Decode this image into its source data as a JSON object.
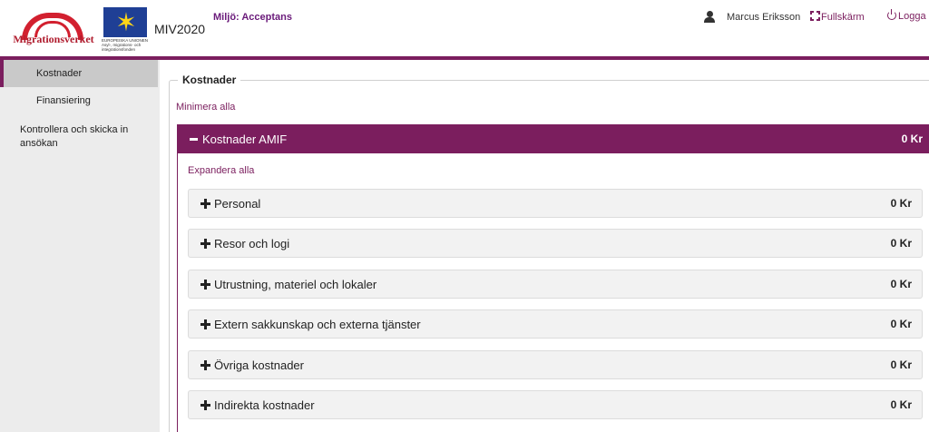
{
  "header": {
    "logo_text": "Migrationsverket",
    "eu_logo_text": "EUROPEISKA UNIONEN Asyl-, migrations- och integrationsfonden",
    "app_name": "MIV2020",
    "environment": "Miljö: Acceptans",
    "user_name": "Marcus Eriksson",
    "fullscreen_label": "Fullskärm",
    "logout_label": "Logga"
  },
  "sidebar": {
    "items": [
      {
        "label": "Kostnader",
        "active": true
      },
      {
        "label": "Finansiering",
        "active": false
      },
      {
        "label": "Kontrollera och skicka in ansökan",
        "active": false
      }
    ]
  },
  "main": {
    "legend": "Kostnader",
    "minimize_all": "Minimera alla",
    "panel": {
      "title": "Kostnader AMIF",
      "total": "0 Kr",
      "expand_all": "Expandera alla",
      "rows": [
        {
          "label": "Personal",
          "amount": "0 Kr"
        },
        {
          "label": "Resor och logi",
          "amount": "0 Kr"
        },
        {
          "label": "Utrustning, materiel och lokaler",
          "amount": "0 Kr"
        },
        {
          "label": "Extern sakkunskap och externa tjänster",
          "amount": "0 Kr"
        },
        {
          "label": "Övriga kostnader",
          "amount": "0 Kr"
        },
        {
          "label": "Indirekta kostnader",
          "amount": "0 Kr"
        }
      ]
    }
  },
  "colors": {
    "accent": "#7b1e5e",
    "brand_red": "#d2202f",
    "eu_blue": "#1f3f95"
  },
  "icons": [
    "user-icon",
    "fullscreen-icon",
    "power-icon",
    "minus-icon",
    "plus-icon"
  ]
}
